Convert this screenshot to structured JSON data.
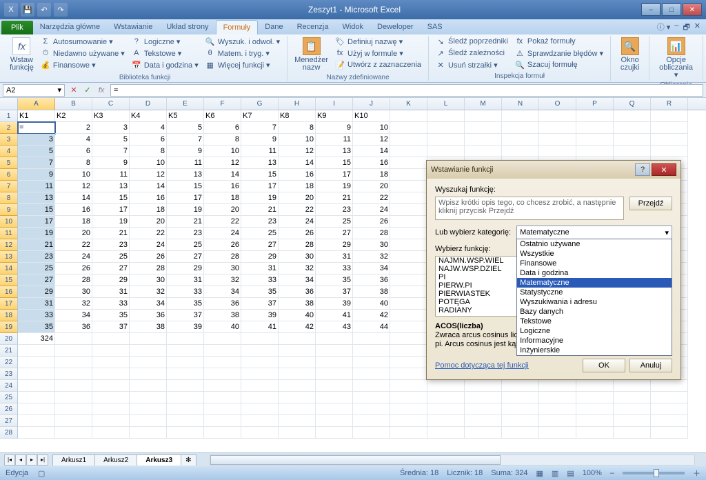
{
  "window": {
    "title": "Zeszyt1 - Microsoft Excel"
  },
  "tabs": {
    "file": "Plik",
    "items": [
      "Narzędzia główne",
      "Wstawianie",
      "Układ strony",
      "Formuły",
      "Dane",
      "Recenzja",
      "Widok",
      "Deweloper",
      "SAS"
    ],
    "active": "Formuły"
  },
  "ribbon": {
    "g1": {
      "big": "Wstaw funkcję",
      "label": "Biblioteka funkcji",
      "col1": [
        "Autosumowanie ▾",
        "Niedawno używane ▾",
        "Finansowe ▾"
      ],
      "col2": [
        "Logiczne ▾",
        "Tekstowe ▾",
        "Data i godzina ▾"
      ],
      "col3": [
        "Wyszuk. i odwoł. ▾",
        "Matem. i tryg. ▾",
        "Więcej funkcji ▾"
      ]
    },
    "g2": {
      "big": "Menedżer nazw",
      "label": "Nazwy zdefiniowane",
      "col": [
        "Definiuj nazwę ▾",
        "Użyj w formule ▾",
        "Utwórz z zaznaczenia"
      ]
    },
    "g3": {
      "label": "Inspekcja formuł",
      "col1": [
        "Śledź poprzedniki",
        "Śledź zależności",
        "Usuń strzałki ▾"
      ],
      "col2": [
        "Pokaż formuły",
        "Sprawdzanie błędów ▾",
        "Szacuj formułę"
      ]
    },
    "g4": {
      "big": "Okno czujki"
    },
    "g5": {
      "big": "Opcje obliczania ▾",
      "label": "Obliczanie"
    }
  },
  "formula_bar": {
    "name": "A2",
    "content": "="
  },
  "columns": [
    "A",
    "B",
    "C",
    "D",
    "E",
    "F",
    "G",
    "H",
    "I",
    "J",
    "K",
    "L",
    "M",
    "N",
    "O",
    "P",
    "Q",
    "R"
  ],
  "headers_row": [
    "K1",
    "K2",
    "K3",
    "K4",
    "K5",
    "K6",
    "K7",
    "K8",
    "K9",
    "K10"
  ],
  "data_rows": [
    [
      "=",
      "2",
      "3",
      "4",
      "5",
      "6",
      "7",
      "8",
      "9",
      "10"
    ],
    [
      "3",
      "4",
      "5",
      "6",
      "7",
      "8",
      "9",
      "10",
      "11",
      "12"
    ],
    [
      "5",
      "6",
      "7",
      "8",
      "9",
      "10",
      "11",
      "12",
      "13",
      "14"
    ],
    [
      "7",
      "8",
      "9",
      "10",
      "11",
      "12",
      "13",
      "14",
      "15",
      "16"
    ],
    [
      "9",
      "10",
      "11",
      "12",
      "13",
      "14",
      "15",
      "16",
      "17",
      "18"
    ],
    [
      "11",
      "12",
      "13",
      "14",
      "15",
      "16",
      "17",
      "18",
      "19",
      "20"
    ],
    [
      "13",
      "14",
      "15",
      "16",
      "17",
      "18",
      "19",
      "20",
      "21",
      "22"
    ],
    [
      "15",
      "16",
      "17",
      "18",
      "19",
      "20",
      "21",
      "22",
      "23",
      "24"
    ],
    [
      "17",
      "18",
      "19",
      "20",
      "21",
      "22",
      "23",
      "24",
      "25",
      "26"
    ],
    [
      "19",
      "20",
      "21",
      "22",
      "23",
      "24",
      "25",
      "26",
      "27",
      "28"
    ],
    [
      "21",
      "22",
      "23",
      "24",
      "25",
      "26",
      "27",
      "28",
      "29",
      "30"
    ],
    [
      "23",
      "24",
      "25",
      "26",
      "27",
      "28",
      "29",
      "30",
      "31",
      "32"
    ],
    [
      "25",
      "26",
      "27",
      "28",
      "29",
      "30",
      "31",
      "32",
      "33",
      "34"
    ],
    [
      "27",
      "28",
      "29",
      "30",
      "31",
      "32",
      "33",
      "34",
      "35",
      "36"
    ],
    [
      "29",
      "30",
      "31",
      "32",
      "33",
      "34",
      "35",
      "36",
      "37",
      "38"
    ],
    [
      "31",
      "32",
      "33",
      "34",
      "35",
      "36",
      "37",
      "38",
      "39",
      "40"
    ],
    [
      "33",
      "34",
      "35",
      "36",
      "37",
      "38",
      "39",
      "40",
      "41",
      "42"
    ],
    [
      "35",
      "36",
      "37",
      "38",
      "39",
      "40",
      "41",
      "42",
      "43",
      "44"
    ]
  ],
  "row20_A": "324",
  "sheets": {
    "items": [
      "Arkusz1",
      "Arkusz2",
      "Arkusz3"
    ],
    "active": "Arkusz3"
  },
  "status": {
    "mode": "Edycja",
    "avg_l": "Średnia:",
    "avg_v": "18",
    "cnt_l": "Licznik:",
    "cnt_v": "18",
    "sum_l": "Suma:",
    "sum_v": "324",
    "zoom": "100%"
  },
  "dialog": {
    "title": "Wstawianie funkcji",
    "search_label": "Wyszukaj funkcję:",
    "search_text": "Wpisz krótki opis tego, co chcesz zrobić, a następnie kliknij przycisk Przejdź",
    "go": "Przejdź",
    "cat_label": "Lub wybierz kategorię:",
    "cat_value": "Matematyczne",
    "categories": [
      "Ostatnio używane",
      "Wszystkie",
      "Finansowe",
      "Data i godzina",
      "Matematyczne",
      "Statystyczne",
      "Wyszukiwania i adresu",
      "Bazy danych",
      "Tekstowe",
      "Logiczne",
      "Informacyjne",
      "Inżynierskie"
    ],
    "pick_label": "Wybierz funkcję:",
    "functions": [
      "NAJMN.WSP.WIEL",
      "NAJW.WSP.DZIEL",
      "PI",
      "PIERW.PI",
      "PIERWIASTEK",
      "POTĘGA",
      "RADIANY"
    ],
    "desc_title": "ACOS(liczba)",
    "desc_body": "Zwraca arcus cosinus liczby wyrażony w radianach w zakresie od 0 do pi. Arcus cosinus jest kątem, którego cosinus daje liczbę.",
    "help": "Pomoc dotycząca tej funkcji",
    "ok": "OK",
    "cancel": "Anuluj"
  }
}
